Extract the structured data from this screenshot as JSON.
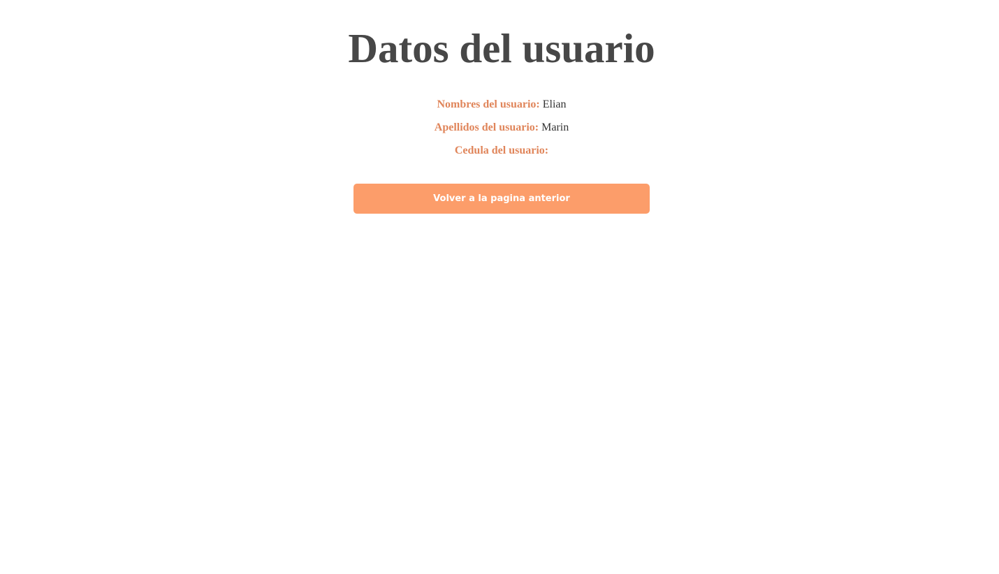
{
  "page": {
    "title": "Datos del usuario"
  },
  "user": {
    "fields": [
      {
        "label": "Nombres del usuario:",
        "value": "Elian"
      },
      {
        "label": "Apellidos del usuario:",
        "value": "Marin"
      },
      {
        "label": "Cedula del usuario:",
        "value": ""
      }
    ]
  },
  "actions": {
    "back_label": "Volver a la pagina anterior"
  },
  "colors": {
    "label": "#e0855a",
    "button": "#fc9d6a",
    "title": "#474747"
  }
}
